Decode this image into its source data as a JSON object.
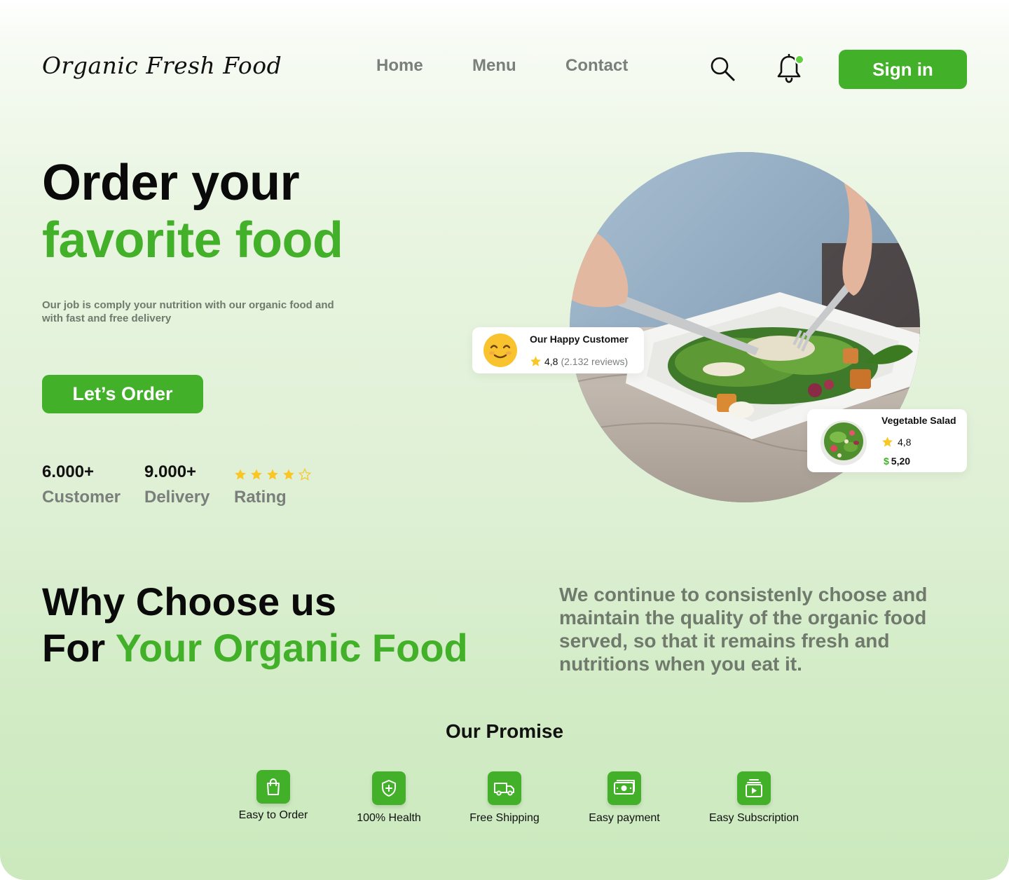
{
  "nav": {
    "logo": "Organic Fresh Food",
    "links": [
      "Home",
      "Menu",
      "Contact"
    ],
    "sign_in": "Sign in"
  },
  "hero": {
    "title_line1": "Order your",
    "title_line2": "favorite food",
    "description": "Our job is comply your nutrition with our organic food and with fast and free delivery",
    "cta": "Let’s Order",
    "stats": [
      {
        "value": "6.000+",
        "label": "Customer"
      },
      {
        "value": "9.000+",
        "label": "Delivery"
      },
      {
        "label": "Rating",
        "stars_filled": 4,
        "stars_total": 5
      }
    ]
  },
  "customer_card": {
    "title": "Our Happy Customer",
    "rating": "4,8",
    "reviews": "(2.132 reviews)"
  },
  "salad_card": {
    "title": "Vegetable Salad",
    "rating": "4,8",
    "currency": "$",
    "price": "5,20"
  },
  "why": {
    "line1": "Why Choose us",
    "line2_prefix": "For ",
    "line2_accent": "Your Organic Food",
    "description": "We continue to consistenly choose and maintain the quality of the organic food served, so that it remains fresh and nutritions when you eat it."
  },
  "promise": {
    "title": "Our Promise",
    "items": [
      {
        "label": "Easy to Order",
        "icon": "shopping-bag-icon"
      },
      {
        "label": "100% Health",
        "icon": "shield-plus-icon"
      },
      {
        "label": "Free Shipping",
        "icon": "truck-icon"
      },
      {
        "label": "Easy payment",
        "icon": "money-icon"
      },
      {
        "label": "Easy Subscription",
        "icon": "subscription-play-icon"
      }
    ]
  },
  "colors": {
    "accent": "#43b02a",
    "muted_text": "#7b7f7b",
    "star": "#f9c623"
  }
}
